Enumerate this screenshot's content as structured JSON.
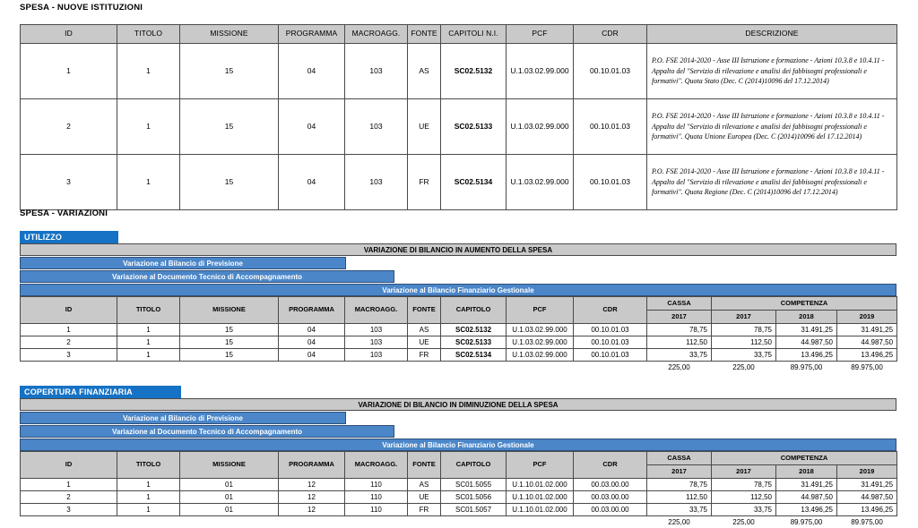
{
  "colors": {
    "badge_blue": "#1572c4",
    "band_blue": "#4a86c8",
    "header_grey": "#c9c9c9",
    "border": "#4a4a4a"
  },
  "sections": {
    "nuove_istituzioni": {
      "caption": "SPESA - NUOVE ISTITUZIONI",
      "columns": [
        "ID",
        "TITOLO",
        "MISSIONE",
        "PROGRAMMA",
        "MACROAGG.",
        "FONTE",
        "CAPITOLI N.I.",
        "PCF",
        "CDR",
        "DESCRIZIONE"
      ],
      "rows": [
        {
          "id": "1",
          "titolo": "1",
          "missione": "15",
          "programma": "04",
          "macroagg": "103",
          "fonte": "AS",
          "capitolo": "SC02.5132",
          "pcf": "U.1.03.02.99.000",
          "cdr": "00.10.01.03",
          "descrizione": "P.O. FSE 2014-2020 - Asse III Istruzione e formazione - Azioni 10.3.8 e 10.4.11 - Appalto del \"Servizio di rilevazione e analisi dei fabbisogni professionali e formativi\". Quota Stato (Dec. C (2014)10096 del 17.12.2014)"
        },
        {
          "id": "2",
          "titolo": "1",
          "missione": "15",
          "programma": "04",
          "macroagg": "103",
          "fonte": "UE",
          "capitolo": "SC02.5133",
          "pcf": "U.1.03.02.99.000",
          "cdr": "00.10.01.03",
          "descrizione": "P.O. FSE 2014-2020 - Asse III Istruzione e formazione - Azioni 10.3.8 e 10.4.11 - Appalto del \"Servizio di rilevazione e analisi dei fabbisogni professionali e formativi\". Quota Unione Europea (Dec. C (2014)10096 del 17.12.2014)"
        },
        {
          "id": "3",
          "titolo": "1",
          "missione": "15",
          "programma": "04",
          "macroagg": "103",
          "fonte": "FR",
          "capitolo": "SC02.5134",
          "pcf": "U.1.03.02.99.000",
          "cdr": "00.10.01.03",
          "descrizione": "P.O. FSE 2014-2020 - Asse III Istruzione e formazione - Azioni 10.3.8 e 10.4.11 - Appalto del \"Servizio di rilevazione e analisi dei fabbisogni professionali e formativi\". Quota Regione (Dec. C (2014)10096 del 17.12.2014)"
        }
      ]
    },
    "variazioni": {
      "caption": "SPESA - VARIAZIONI",
      "blocks": [
        {
          "badge": "UTILIZZO",
          "band_grey": "VARIAZIONE DI BILANCIO IN AUMENTO DELLA SPESA",
          "band_prev": "Variazione al Bilancio di Previsione",
          "band_doc": "Variazione al Documento Tecnico di Accompagnamento",
          "band_gest": "Variazione al Bilancio Finanziario Gestionale",
          "columns": [
            "ID",
            "TITOLO",
            "MISSIONE",
            "PROGRAMMA",
            "MACROAGG.",
            "FONTE",
            "CAPITOLO",
            "PCF",
            "CDR"
          ],
          "group_cassa": "CASSA",
          "group_competenza": "COMPETENZA",
          "years_cassa": [
            "2017"
          ],
          "years_competenza": [
            "2017",
            "2018",
            "2019"
          ],
          "capitolo_bold": true,
          "rows": [
            {
              "id": "1",
              "titolo": "1",
              "missione": "15",
              "programma": "04",
              "macroagg": "103",
              "fonte": "AS",
              "capitolo": "SC02.5132",
              "pcf": "U.1.03.02.99.000",
              "cdr": "00.10.01.03",
              "cassa_2017": "78,75",
              "comp_2017": "78,75",
              "comp_2018": "31.491,25",
              "comp_2019": "31.491,25"
            },
            {
              "id": "2",
              "titolo": "1",
              "missione": "15",
              "programma": "04",
              "macroagg": "103",
              "fonte": "UE",
              "capitolo": "SC02.5133",
              "pcf": "U.1.03.02.99.000",
              "cdr": "00.10.01.03",
              "cassa_2017": "112,50",
              "comp_2017": "112,50",
              "comp_2018": "44.987,50",
              "comp_2019": "44.987,50"
            },
            {
              "id": "3",
              "titolo": "1",
              "missione": "15",
              "programma": "04",
              "macroagg": "103",
              "fonte": "FR",
              "capitolo": "SC02.5134",
              "pcf": "U.1.03.02.99.000",
              "cdr": "00.10.01.03",
              "cassa_2017": "33,75",
              "comp_2017": "33,75",
              "comp_2018": "13.496,25",
              "comp_2019": "13.496,25"
            }
          ],
          "totals": {
            "cassa_2017": "225,00",
            "comp_2017": "225,00",
            "comp_2018": "89.975,00",
            "comp_2019": "89.975,00"
          }
        },
        {
          "badge": "COPERTURA FINANZIARIA",
          "band_grey": "VARIAZIONE DI BILANCIO IN DIMINUZIONE DELLA SPESA",
          "band_prev": "Variazione al Bilancio di Previsione",
          "band_doc": "Variazione al Documento Tecnico di Accompagnamento",
          "band_gest": "Variazione al Bilancio Finanziario Gestionale",
          "columns": [
            "ID",
            "TITOLO",
            "MISSIONE",
            "PROGRAMMA",
            "MACROAGG.",
            "FONTE",
            "CAPITOLO",
            "PCF",
            "CDR"
          ],
          "group_cassa": "CASSA",
          "group_competenza": "COMPETENZA",
          "years_cassa": [
            "2017"
          ],
          "years_competenza": [
            "2017",
            "2018",
            "2019"
          ],
          "capitolo_bold": false,
          "rows": [
            {
              "id": "1",
              "titolo": "1",
              "missione": "01",
              "programma": "12",
              "macroagg": "110",
              "fonte": "AS",
              "capitolo": "SC01.5055",
              "pcf": "U.1.10.01.02.000",
              "cdr": "00.03.00.00",
              "cassa_2017": "78,75",
              "comp_2017": "78,75",
              "comp_2018": "31.491,25",
              "comp_2019": "31.491,25"
            },
            {
              "id": "2",
              "titolo": "1",
              "missione": "01",
              "programma": "12",
              "macroagg": "110",
              "fonte": "UE",
              "capitolo": "SC01.5056",
              "pcf": "U.1.10.01.02.000",
              "cdr": "00.03.00.00",
              "cassa_2017": "112,50",
              "comp_2017": "112,50",
              "comp_2018": "44.987,50",
              "comp_2019": "44.987,50"
            },
            {
              "id": "3",
              "titolo": "1",
              "missione": "01",
              "programma": "12",
              "macroagg": "110",
              "fonte": "FR",
              "capitolo": "SC01.5057",
              "pcf": "U.1.10.01.02.000",
              "cdr": "00.03.00.00",
              "cassa_2017": "33,75",
              "comp_2017": "33,75",
              "comp_2018": "13.496,25",
              "comp_2019": "13.496,25"
            }
          ],
          "totals": {
            "cassa_2017": "225,00",
            "comp_2017": "225,00",
            "comp_2018": "89.975,00",
            "comp_2019": "89.975,00"
          }
        }
      ]
    }
  }
}
